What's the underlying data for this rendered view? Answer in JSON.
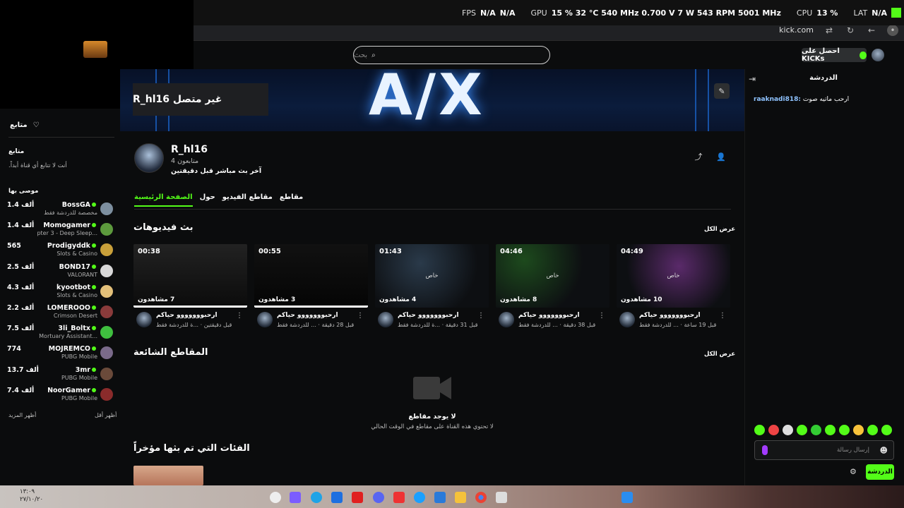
{
  "overlay": {
    "fps_label": "FPS",
    "fps_value": "N/A",
    "fps_value2": "N/A",
    "gpu_label": "GPU",
    "gpu_stats": "15 % 32 °C 540 MHz 0.700 V 7 W 543 RPM 5001 MHz",
    "cpu_label": "CPU",
    "cpu_value": "13 %",
    "lat_label": "LAT",
    "lat_value": "N/A"
  },
  "browser": {
    "url": "kick.com"
  },
  "search": {
    "placeholder": "بحث"
  },
  "header": {
    "kicks_button": "احصل على KICKs"
  },
  "banner": {
    "big_text": "A/X",
    "offline_text": "غير متصل R_hl16"
  },
  "sidebar": {
    "following_title": "متابع",
    "following_heading": "متابع",
    "following_empty": "أنت لا تتابع أي قناة أبداً.",
    "recommended_title": "موصى بها",
    "show_more": "أظهر المزيد",
    "show_less": "أظهر أقل",
    "channels": [
      {
        "name": "BossGA",
        "category": "مخصصة للدردشة فقط",
        "viewers": "1.4 ألف",
        "color": "#7d8f9f"
      },
      {
        "name": "Momogamer",
        "category": "...pter 3 - Deep Sleep",
        "viewers": "1.4 ألف",
        "color": "#5d9a3d"
      },
      {
        "name": "Prodigyddk",
        "category": "Slots & Casino",
        "viewers": "565",
        "color": "#c9a03a"
      },
      {
        "name": "BOND17",
        "category": "VALORANT",
        "viewers": "2.5 ألف",
        "color": "#d8d8d8"
      },
      {
        "name": "kyootbot",
        "category": "Slots & Casino",
        "viewers": "4.3 ألف",
        "color": "#e3c07a"
      },
      {
        "name": "LOMEROOO",
        "category": "Crimson Desert",
        "viewers": "2.2 ألف",
        "color": "#8a3b3b"
      },
      {
        "name": "3li_Boltx",
        "category": "...Mortuary Assistant",
        "viewers": "7.5 ألف",
        "color": "#3fbf3f"
      },
      {
        "name": "MOJREMCO",
        "category": "PUBG Mobile",
        "viewers": "774",
        "color": "#7a6a8a"
      },
      {
        "name": "3mr",
        "category": "PUBG Mobile",
        "viewers": "13.7 ألف",
        "color": "#6a4a3a"
      },
      {
        "name": "NoorGamer",
        "category": "PUBG Mobile",
        "viewers": "7.4 ألف",
        "color": "#8a2b2b"
      }
    ]
  },
  "channel": {
    "name": "R_hl16",
    "followers": "4 متابعون",
    "last_live": "آخر بث مباشر قبل دقيقتين",
    "tabs": [
      "مقاطع",
      "مقاطع الفيديو",
      "حول",
      "الصفحة الرئيسية"
    ]
  },
  "vods": {
    "title": "بث فيديوهات",
    "show_all": "عرض الكل",
    "items": [
      {
        "duration": "00:38",
        "views": "7 مشاهدون",
        "title": "ارحبووووووو حياكم",
        "subtitle": "قبل دقيقتين · ...ة للدردشة فقط",
        "private": "",
        "progress": 1.0
      },
      {
        "duration": "00:55",
        "views": "3 مشاهدون",
        "title": "ارحبووووووو حياكم",
        "subtitle": "قبل 28 دقيقة · ... للدردشة فقط",
        "private": "",
        "progress": 1.0
      },
      {
        "duration": "01:43",
        "views": "4 مشاهدون",
        "title": "ارحبووووووو حياكم",
        "subtitle": "قبل 31 دقيقة · ...ة للدردشة فقط",
        "private": "خاص",
        "progress": 0
      },
      {
        "duration": "04:46",
        "views": "8 مشاهدون",
        "title": "ارحبووووووو حياكم",
        "subtitle": "قبل 38 دقيقة · ... للدردشة فقط",
        "private": "خاص",
        "progress": 0
      },
      {
        "duration": "04:49",
        "views": "10 مشاهدون",
        "title": "ارحبووووووو حياكم",
        "subtitle": "قبل 19 ساعة · ... للدردشة فقط",
        "private": "خاص",
        "progress": 0
      }
    ]
  },
  "clips": {
    "title": "المقاطع الشائعة",
    "show_all": "عرض الكل",
    "empty_title": "لا يوجد مقاطع",
    "empty_subtitle": "لا تحتوي هذه القناة على مقاطع في الوقت الحالي"
  },
  "categories": {
    "title": "الفئات التي تم بثها مؤخراً"
  },
  "chat": {
    "title": "الدردشة",
    "message_user": "raaknadi818:",
    "message_text": "ارحب ماتيه صوت",
    "input_placeholder": "إرسال رسالة",
    "send_label": "الدردشة"
  },
  "taskbar": {
    "time": "١٣:٠٩",
    "date": "٢٧/١٠/٢٠"
  }
}
